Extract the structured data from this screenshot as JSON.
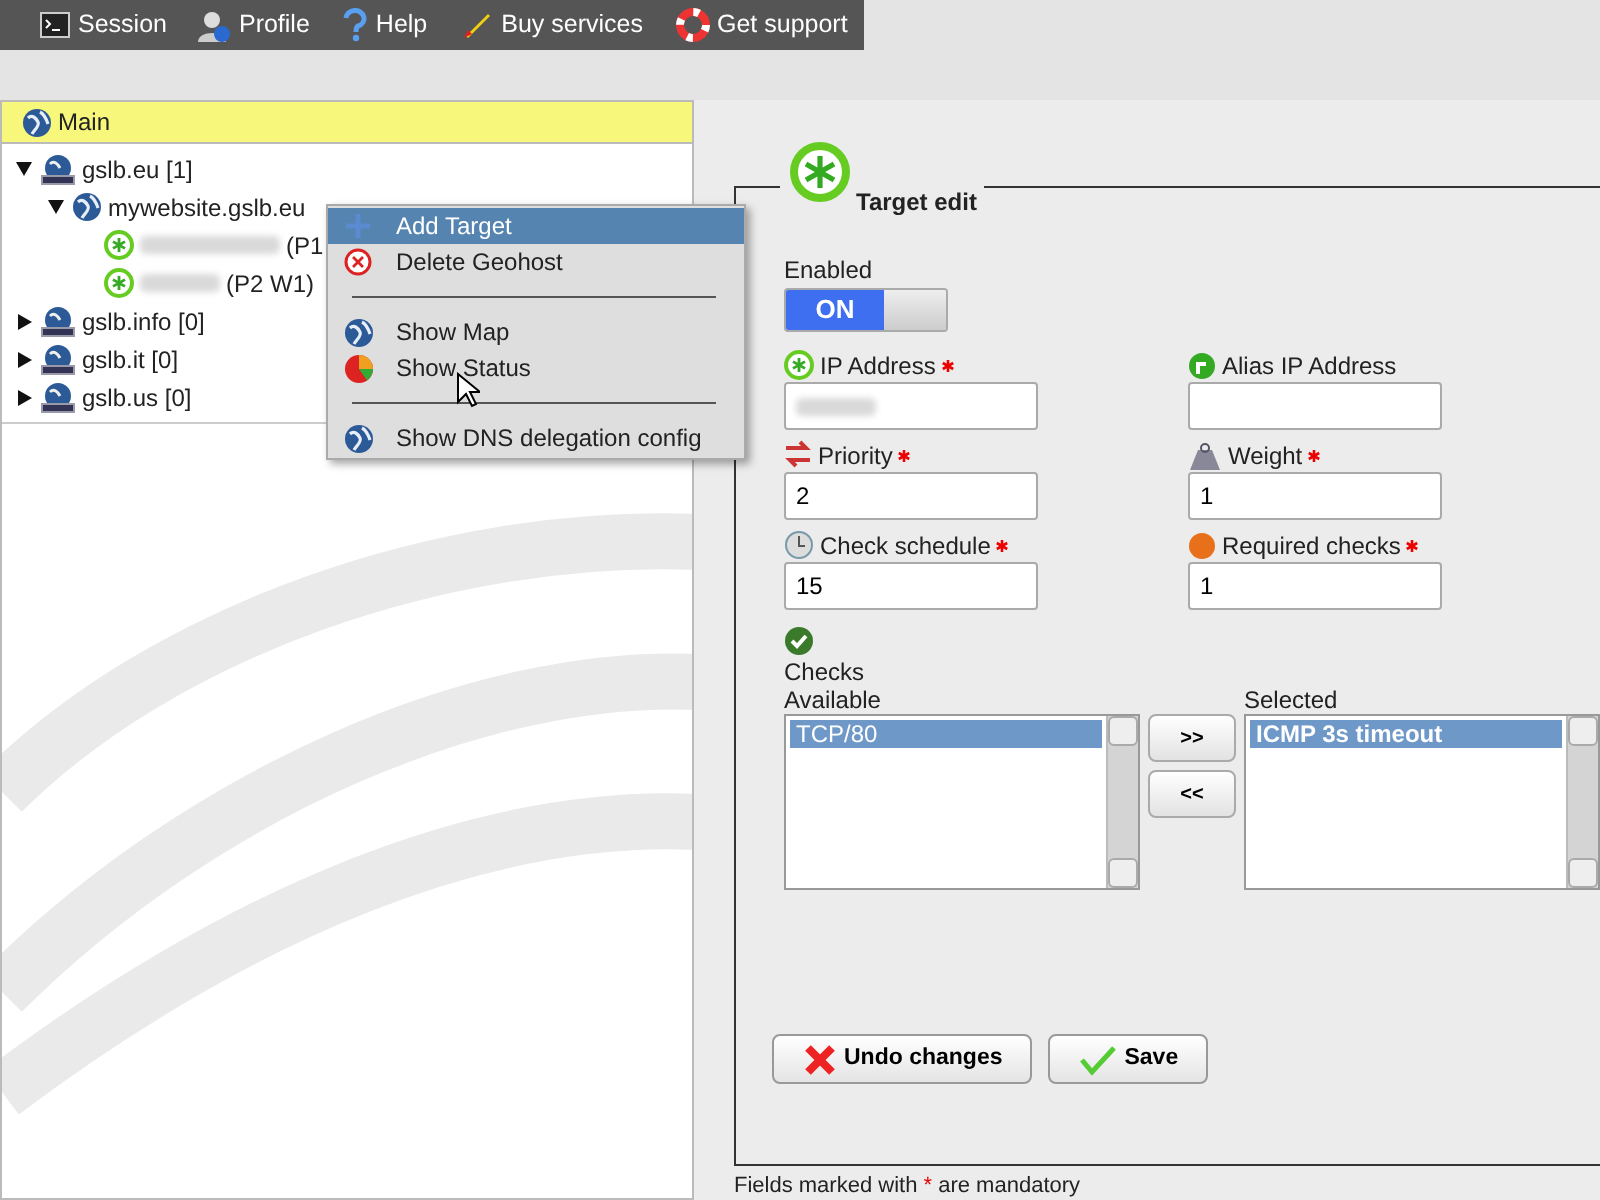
{
  "menu_bar": [
    {
      "label": "Session"
    },
    {
      "label": "Profile"
    },
    {
      "label": "Help"
    },
    {
      "label": "Buy services"
    },
    {
      "label": "Get support"
    }
  ],
  "panel": {
    "title": "Main"
  },
  "tree": [
    {
      "label": "gslb.eu [1]",
      "expanded": true,
      "children": [
        {
          "label": "mywebsite.gslb.eu",
          "expanded": true,
          "children": [
            {
              "label": "(P1",
              "blurred_prefix": true
            },
            {
              "label": "(P2 W1)",
              "blurred_prefix": true
            }
          ]
        }
      ]
    },
    {
      "label": "gslb.info [0]",
      "expanded": false
    },
    {
      "label": "gslb.it [0]",
      "expanded": false
    },
    {
      "label": "gslb.us [0]",
      "expanded": false
    }
  ],
  "context_menu": [
    {
      "kind": "item",
      "label": "Add Target",
      "selected": true
    },
    {
      "kind": "item",
      "label": "Delete Geohost",
      "selected": false
    },
    {
      "kind": "separator"
    },
    {
      "kind": "item",
      "label": "Show Map",
      "selected": false
    },
    {
      "kind": "item",
      "label": "Show Status",
      "selected": false
    },
    {
      "kind": "separator"
    },
    {
      "kind": "item",
      "label": "Show DNS delegation config",
      "selected": false
    }
  ],
  "form": {
    "title": "Target edit",
    "enabled": {
      "label": "Enabled",
      "on": true,
      "on_text": "ON"
    },
    "fields": [
      {
        "label": "IP Address",
        "required": true,
        "blurred": true
      },
      {
        "label": "Alias IP Address",
        "required": false
      },
      {
        "label": "Priority",
        "required": true,
        "value": "2"
      },
      {
        "label": "Weight",
        "required": true,
        "value": "1"
      },
      {
        "label": "Check schedule",
        "required": true,
        "value": "15"
      },
      {
        "label": "Required checks",
        "required": true,
        "value": "1"
      }
    ],
    "checks": {
      "label": "Checks",
      "available_label": "Available",
      "selected_label": "Selected",
      "available": [
        {
          "label": "TCP/80",
          "selected": true
        }
      ],
      "chosen": [
        {
          "label": "ICMP 3s timeout",
          "selected": true
        }
      ],
      "move_buttons": [
        ">>",
        "<<"
      ]
    },
    "actions": [
      "Undo changes",
      "Save"
    ],
    "note": {
      "before": "Fields marked with",
      "star": "*",
      "after": "are mandatory"
    }
  }
}
